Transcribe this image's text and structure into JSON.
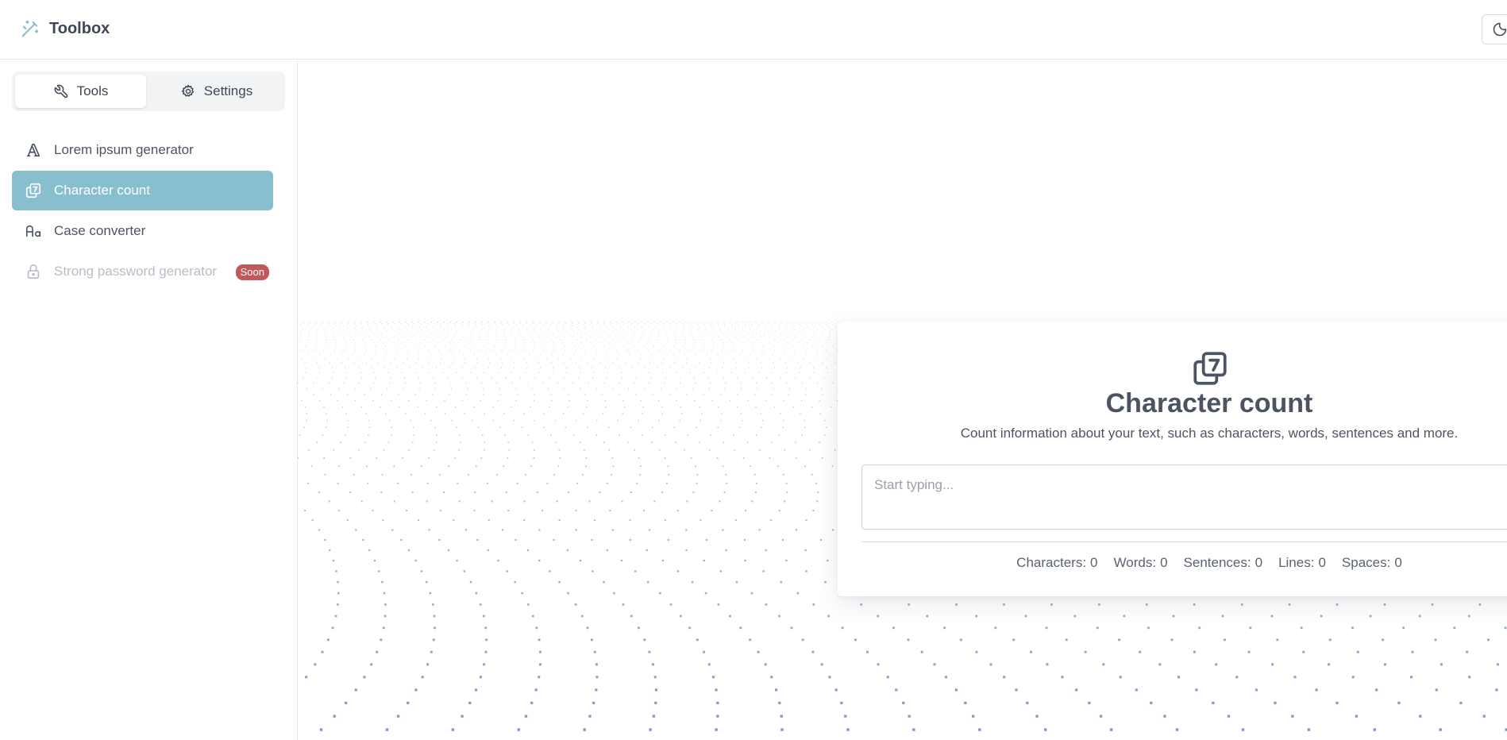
{
  "app": {
    "title": "Toolbox"
  },
  "sidebar": {
    "tabs": [
      {
        "label": "Tools",
        "icon": "tools-icon",
        "active": true
      },
      {
        "label": "Settings",
        "icon": "gear-icon",
        "active": false
      }
    ],
    "items": [
      {
        "label": "Lorem ipsum generator",
        "icon": "typography-icon",
        "state": "normal"
      },
      {
        "label": "Character count",
        "icon": "copy-seven-icon",
        "state": "active"
      },
      {
        "label": "Case converter",
        "icon": "letter-case-icon",
        "state": "normal"
      },
      {
        "label": "Strong password generator",
        "icon": "lock-icon",
        "state": "disabled",
        "badge": "Soon"
      }
    ]
  },
  "tool": {
    "icon": "copy-seven-icon",
    "title": "Character count",
    "description": "Count information about your text, such as characters, words, sentences and more.",
    "input": {
      "placeholder": "Start typing...",
      "value": ""
    },
    "stats": [
      {
        "label": "Characters:",
        "value": "0"
      },
      {
        "label": "Words:",
        "value": "0"
      },
      {
        "label": "Sentences:",
        "value": "0"
      },
      {
        "label": "Lines:",
        "value": "0"
      },
      {
        "label": "Spaces:",
        "value": "0"
      }
    ]
  },
  "colors": {
    "accent": "#88bfcf",
    "badge": "#c2575c",
    "text": "#4c5463",
    "dots": "#6f8fc9"
  }
}
